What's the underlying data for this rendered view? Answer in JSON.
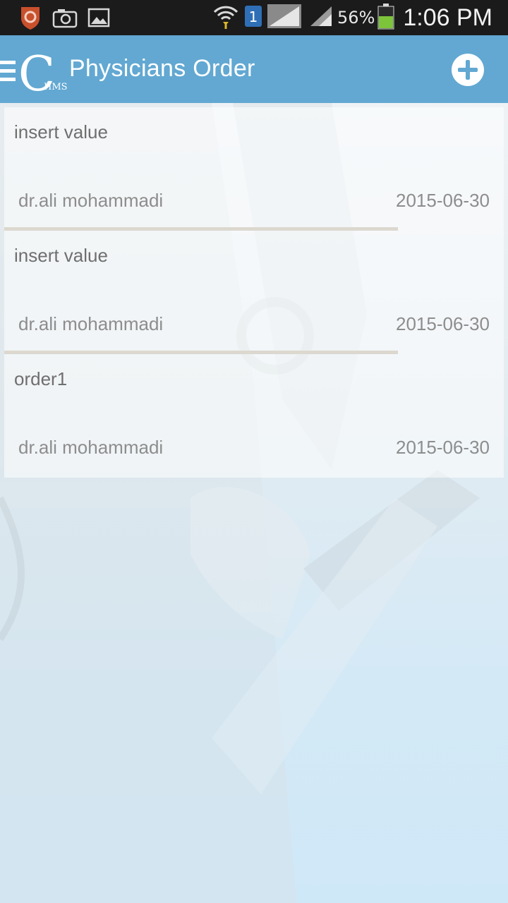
{
  "status_bar": {
    "battery_percent": "56%",
    "time": "1:06 PM",
    "sim_number": "1",
    "icons": [
      "shield-app-icon",
      "camera-icon",
      "gallery-icon",
      "wifi-icon",
      "sim-icon",
      "signal-icon",
      "signal-icon",
      "battery-icon"
    ]
  },
  "app_bar": {
    "logo_letter": "C",
    "logo_sub": "HMS",
    "title": "Physicians Order",
    "accent_color": "#62a8d2"
  },
  "orders": [
    {
      "title": "insert value",
      "doctor": "dr.ali mohammadi",
      "date": "2015-06-30"
    },
    {
      "title": "insert value",
      "doctor": "dr.ali mohammadi",
      "date": "2015-06-30"
    },
    {
      "title": "order1",
      "doctor": "dr.ali mohammadi",
      "date": "2015-06-30"
    }
  ]
}
